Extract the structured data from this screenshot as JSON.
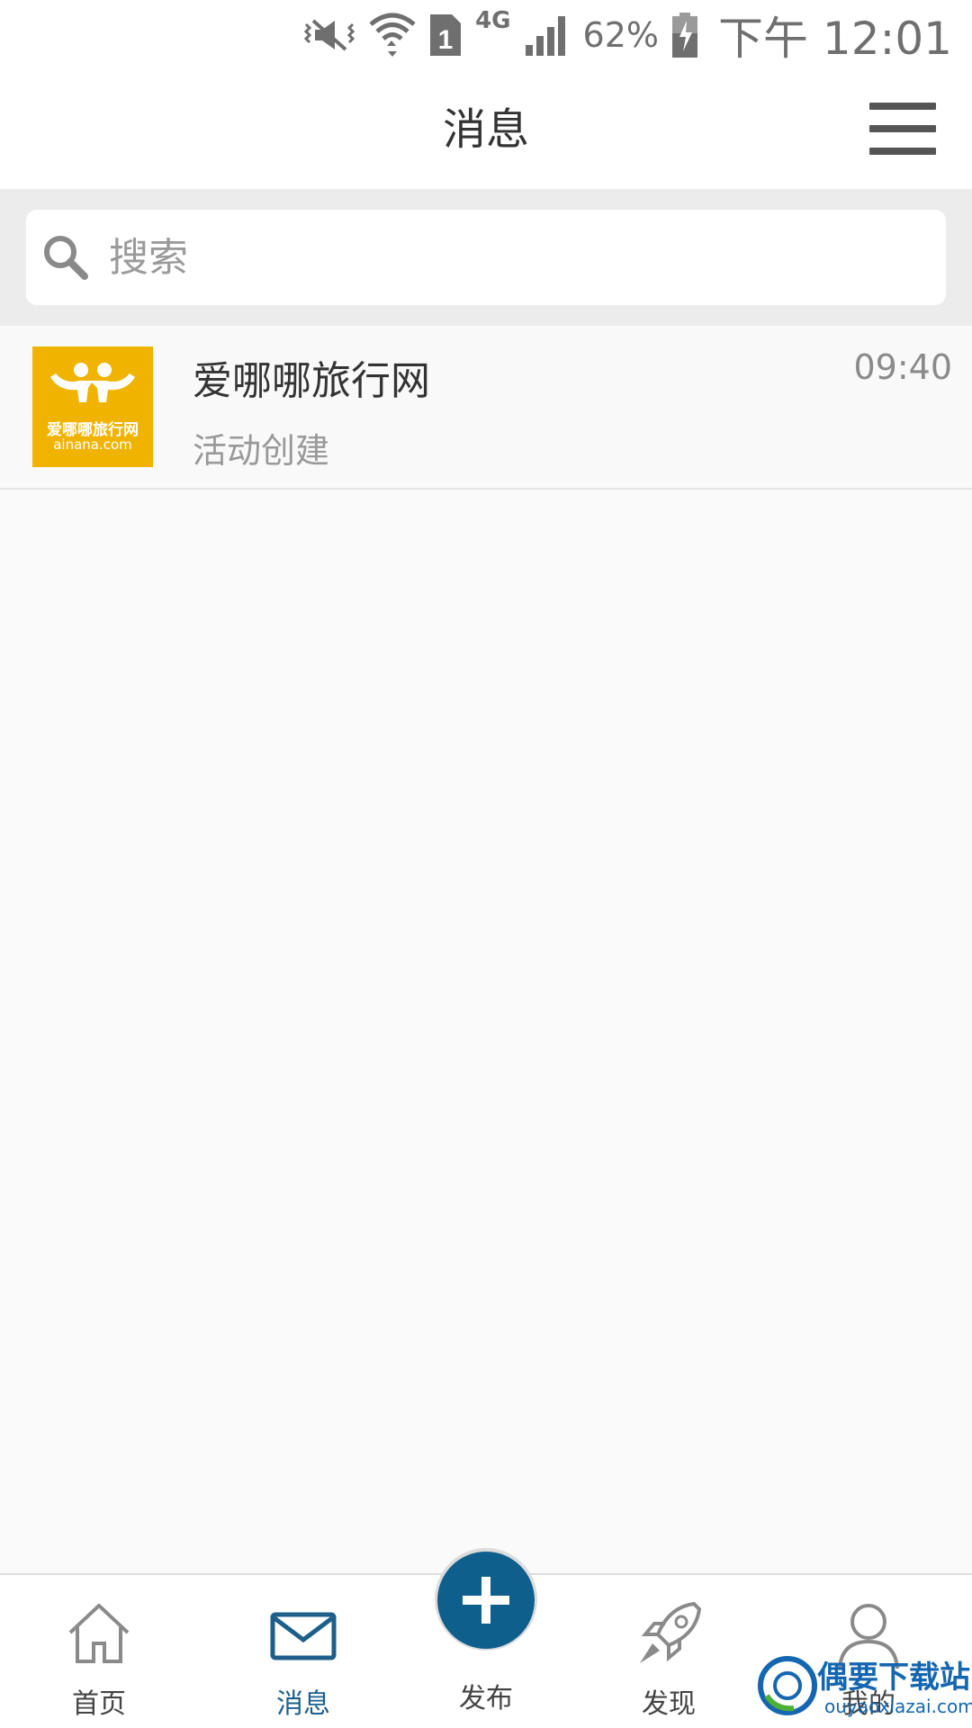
{
  "status_bar": {
    "network_type": "4G",
    "sim_slot": "1",
    "battery": "62%",
    "time": "下午 12:01",
    "icons": [
      "vibrate-mute-icon",
      "wifi-icon",
      "sim-icon",
      "signal-icon",
      "battery-charging-icon"
    ]
  },
  "header": {
    "title": "消息",
    "menu_icon": "hamburger-menu-icon"
  },
  "search": {
    "placeholder": "搜索",
    "value": ""
  },
  "messages": [
    {
      "name": "爱哪哪旅行网",
      "preview": "活动创建",
      "time": "09:40",
      "avatar": {
        "text_cn": "爱哪哪旅行网",
        "text_en": "ainana.com",
        "color": "#f0b400"
      }
    }
  ],
  "bottom_nav": {
    "items": [
      {
        "label": "首页",
        "icon": "home-icon",
        "active": false
      },
      {
        "label": "消息",
        "icon": "mail-icon",
        "active": true
      },
      {
        "label": "发布",
        "icon": "plus-icon",
        "active": false
      },
      {
        "label": "发现",
        "icon": "rocket-icon",
        "active": false
      },
      {
        "label": "我的",
        "icon": "user-icon",
        "active": false
      }
    ]
  },
  "watermark": {
    "title": "偶要下载站",
    "url": "ouyaoxiazai.com"
  },
  "colors": {
    "accent": "#0f5f8d",
    "active_tab": "#1d5f8a",
    "avatar_bg": "#f0b400"
  }
}
